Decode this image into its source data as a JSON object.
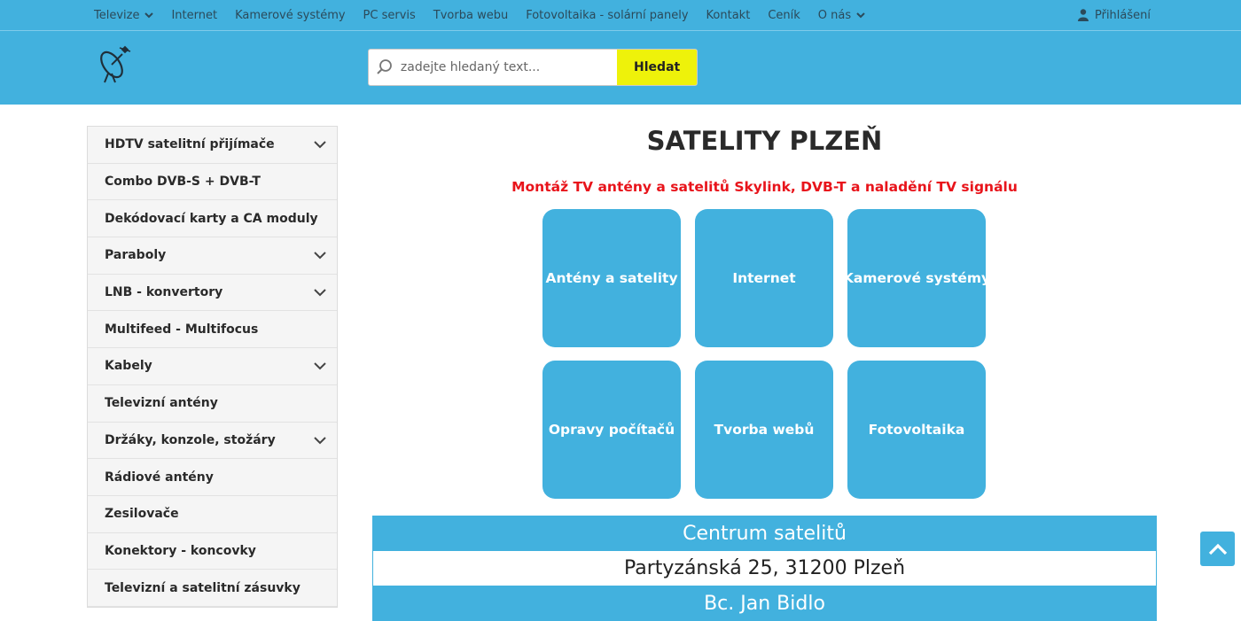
{
  "topnav": {
    "items": [
      {
        "label": "Televize",
        "has_dropdown": true
      },
      {
        "label": "Internet",
        "has_dropdown": false
      },
      {
        "label": "Kamerové systémy",
        "has_dropdown": false
      },
      {
        "label": "PC servis",
        "has_dropdown": false
      },
      {
        "label": "Tvorba webu",
        "has_dropdown": false
      },
      {
        "label": "Fotovoltaika - solární panely",
        "has_dropdown": false
      },
      {
        "label": "Kontakt",
        "has_dropdown": false
      },
      {
        "label": "Ceník",
        "has_dropdown": false
      },
      {
        "label": "O nás",
        "has_dropdown": true
      }
    ],
    "login_label": "Přihlášení"
  },
  "search": {
    "placeholder": "zadejte hledaný text...",
    "value": "",
    "button_label": "Hledat"
  },
  "sidebar": {
    "items": [
      {
        "label": "HDTV satelitní přijímače",
        "has_dropdown": true
      },
      {
        "label": "Combo DVB-S + DVB-T",
        "has_dropdown": false
      },
      {
        "label": "Dekódovací karty a CA moduly",
        "has_dropdown": false
      },
      {
        "label": "Paraboly",
        "has_dropdown": true
      },
      {
        "label": "LNB - konvertory",
        "has_dropdown": true
      },
      {
        "label": "Multifeed - Multifocus",
        "has_dropdown": false
      },
      {
        "label": "Kabely",
        "has_dropdown": true
      },
      {
        "label": "Televizní antény",
        "has_dropdown": false
      },
      {
        "label": "Držáky, konzole, stožáry",
        "has_dropdown": true
      },
      {
        "label": "Rádiové antény",
        "has_dropdown": false
      },
      {
        "label": "Zesilovače",
        "has_dropdown": false
      },
      {
        "label": "Konektory - koncovky",
        "has_dropdown": false
      },
      {
        "label": "Televizní a satelitní zásuvky",
        "has_dropdown": false
      }
    ]
  },
  "main": {
    "title": "SATELITY PLZEŇ",
    "subtitle": "Montáž TV antény a satelitů Skylink, DVB-T a naladění TV signálu",
    "tiles": [
      {
        "label": "Antény a satelity"
      },
      {
        "label": "Internet"
      },
      {
        "label": "Kamerové systémy"
      },
      {
        "label": "Opravy počítačů"
      },
      {
        "label": "Tvorba webů"
      },
      {
        "label": "Fotovoltaika"
      }
    ],
    "info": {
      "company": "Centrum satelitů",
      "address": "Partyzánská 25, 31200 Plzeň",
      "person": "Bc. Jan Bidlo"
    }
  },
  "colors": {
    "brand_blue": "#42b1de",
    "search_button": "#eef20a",
    "subtitle_red": "#e8141b"
  },
  "icons": {
    "logo": "satellite-dish-icon",
    "search": "magnifier-icon",
    "login": "user-icon",
    "scroll_top": "chevron-up-icon"
  }
}
